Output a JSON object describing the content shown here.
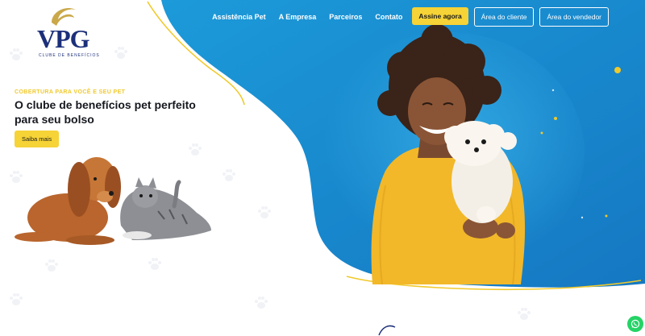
{
  "logo": {
    "mark": "VPG",
    "tagline": "CLUBE DE BENEFÍCIOS"
  },
  "nav": {
    "links": [
      "Assistência Pet",
      "A Empresa",
      "Parceiros",
      "Contato"
    ],
    "subscribe_label": "Assine agora",
    "client_area_label": "Área do cliente",
    "vendor_area_label": "Área do vendedor"
  },
  "hero": {
    "kicker": "COBERTURA PARA VOCÊ E SEU PET",
    "title": "O clube de benefícios pet perfeito para seu bolso",
    "cta_label": "Saiba mais"
  },
  "colors": {
    "brand_blue": "#1a8fd6",
    "accent_yellow": "#f6d336",
    "navy": "#1c2f7a",
    "gold": "#caa84a"
  },
  "icons": {
    "whatsapp": "whatsapp-icon",
    "background_pattern": "paw-print-icon"
  }
}
